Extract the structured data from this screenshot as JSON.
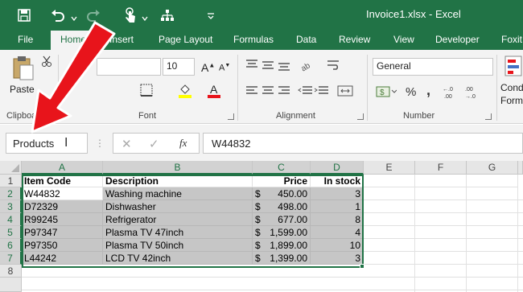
{
  "window": {
    "title": "Invoice1.xlsx - Excel"
  },
  "tabs": [
    {
      "label": "File"
    },
    {
      "label": "Home"
    },
    {
      "label": "Insert"
    },
    {
      "label": "Page Layout"
    },
    {
      "label": "Formulas"
    },
    {
      "label": "Data"
    },
    {
      "label": "Review"
    },
    {
      "label": "View"
    },
    {
      "label": "Developer"
    },
    {
      "label": "Foxit"
    }
  ],
  "ribbon": {
    "clipboard": {
      "paste_label": "Paste",
      "group_label": "Clipboard"
    },
    "font": {
      "size": "10",
      "group_label": "Font"
    },
    "alignment": {
      "group_label": "Alignment"
    },
    "number": {
      "format": "General",
      "group_label": "Number",
      "percent": "%",
      "comma": ","
    },
    "styles": {
      "conditional_label_1": "Conditi",
      "conditional_label_2": "Formatt"
    }
  },
  "formula_bar": {
    "name_box": "Products",
    "fx": "fx",
    "value": "W44832"
  },
  "sheet": {
    "columns": [
      "A",
      "B",
      "C",
      "D",
      "E",
      "F",
      "G"
    ],
    "rows": [
      "1",
      "2",
      "3",
      "4",
      "5",
      "6",
      "7",
      "8"
    ],
    "headers": {
      "a": "Item Code",
      "b": "Description",
      "c": "Price",
      "d": "In stock"
    },
    "data": [
      {
        "code": "W44832",
        "desc": "Washing machine",
        "cur": "$",
        "price": "450.00",
        "stock": "3"
      },
      {
        "code": "D72329",
        "desc": "Dishwasher",
        "cur": "$",
        "price": "498.00",
        "stock": "1"
      },
      {
        "code": "R99245",
        "desc": "Refrigerator",
        "cur": "$",
        "price": "677.00",
        "stock": "8"
      },
      {
        "code": "P97347",
        "desc": "Plasma TV 47inch",
        "cur": "$",
        "price": "1,599.00",
        "stock": "4"
      },
      {
        "code": "P97350",
        "desc": "Plasma TV 50inch",
        "cur": "$",
        "price": "1,899.00",
        "stock": "10"
      },
      {
        "code": "L44242",
        "desc": "LCD TV 42inch",
        "cur": "$",
        "price": "1,399.00",
        "stock": "3"
      }
    ]
  },
  "colors": {
    "excel_green": "#217346",
    "arrow_red": "#e8141b",
    "selection_gray": "#c6c6c6"
  }
}
